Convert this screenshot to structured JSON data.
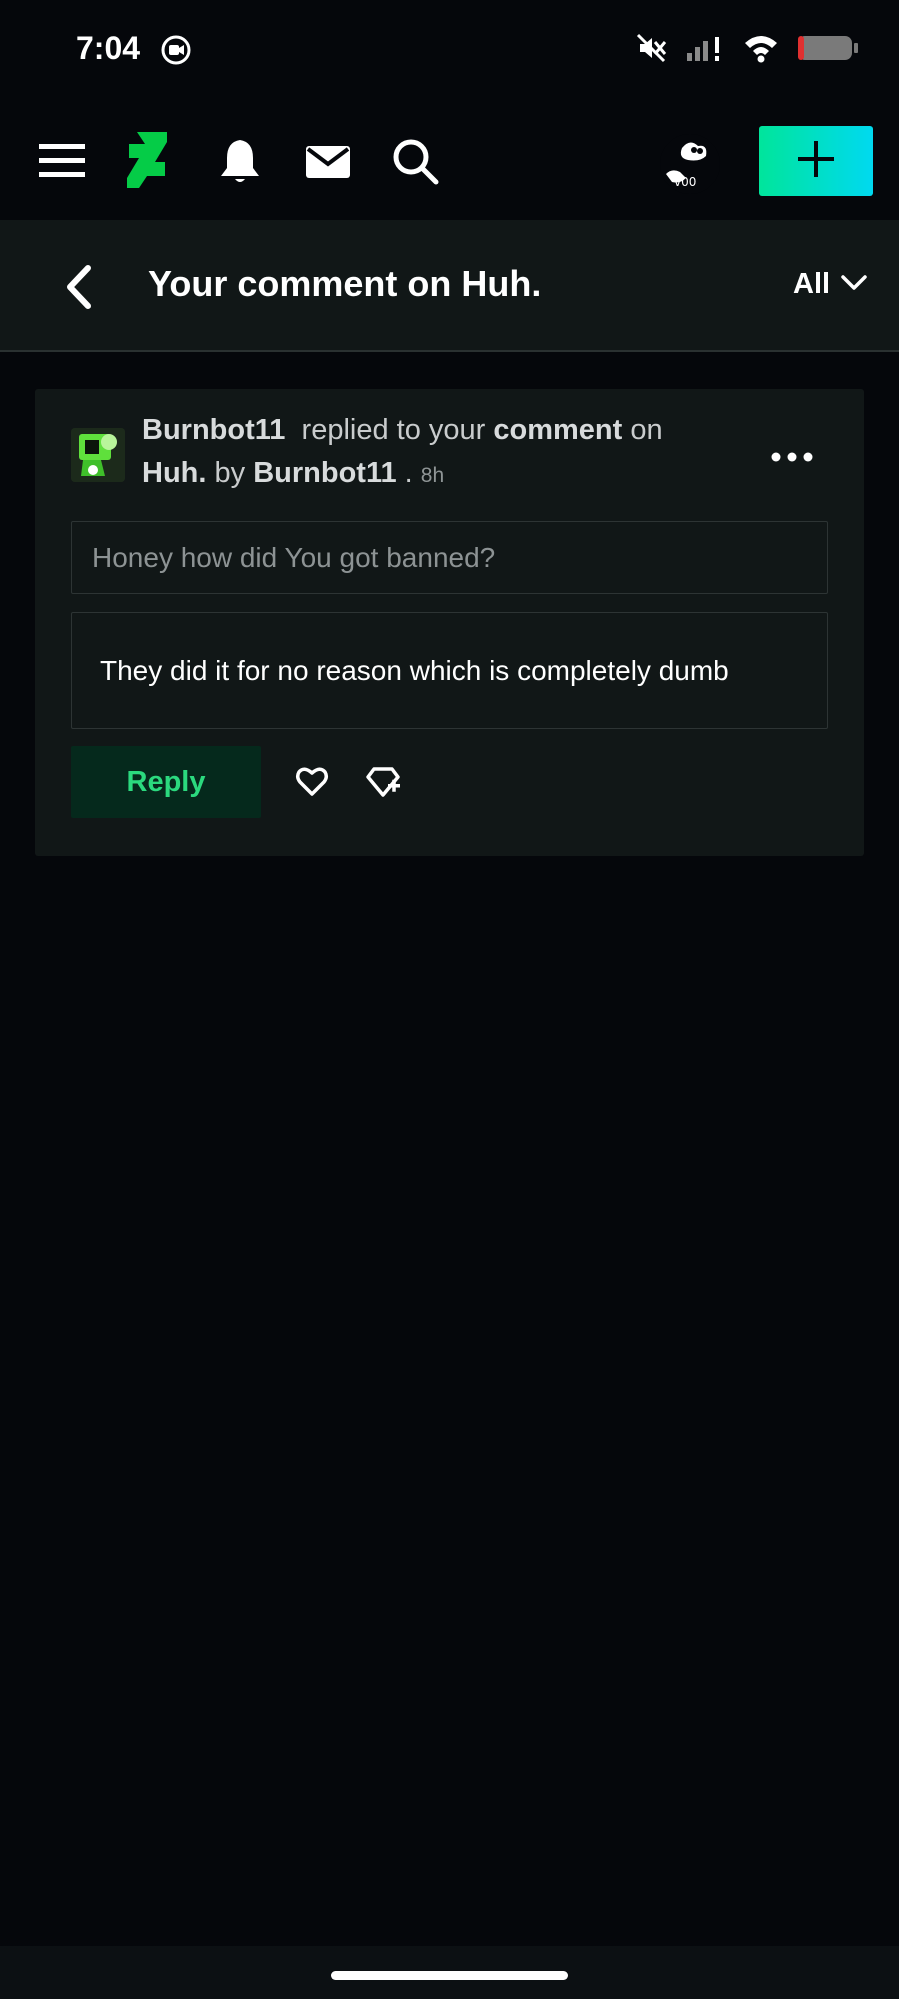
{
  "status_bar": {
    "time": "7:04"
  },
  "nav": {
    "icons": [
      "menu-icon",
      "deviantart-logo-icon",
      "bell-icon",
      "mail-icon",
      "search-icon",
      "avatar",
      "plus-icon"
    ],
    "accent_color": "#05cc47"
  },
  "header": {
    "title": "Your comment on Huh.",
    "filter_label": "All"
  },
  "notification": {
    "username": "Burnbot11",
    "action_text": "replied to your",
    "comment_word": "comment",
    "on_word": "on",
    "deviation_title": "Huh.",
    "by_word": "by",
    "author": "Burnbot11",
    "separator": ".",
    "time_ago": "8h",
    "quoted_comment": "Honey how did You got banned?",
    "reply_text": "They did it for no reason which is completely dumb",
    "reply_button": "Reply"
  },
  "colors": {
    "reply_button_bg": "#05291c",
    "reply_button_text": "#2bd97e",
    "card_bg": "#111717",
    "page_bg": "#05070b"
  }
}
